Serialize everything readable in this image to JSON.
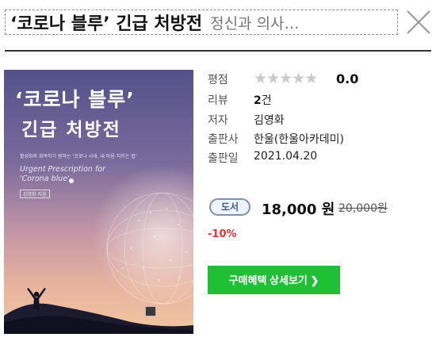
{
  "header": {
    "title": "‘코로나 블루’ 긴급 처방전",
    "subtitle": "정신과 의사…",
    "close_icon": "close-icon"
  },
  "cover": {
    "title_line1": "‘코로나 블루’",
    "title_line2": "긴급 처방전",
    "description": "활성화와 회복하기 원하는 '코로나 시대, 내 마음 지키는 법'",
    "english_title": "Urgent Prescription for 'Corona blue'",
    "author": "김영화 지음"
  },
  "info": {
    "rating": {
      "label": "평점",
      "stars_filled": 0,
      "stars_total": 5,
      "score": "0.0"
    },
    "reviews": {
      "label": "리뷰",
      "count": "2",
      "unit": "건"
    },
    "author": {
      "label": "저자",
      "value": "김영화"
    },
    "publisher": {
      "label": "출판사",
      "value": "한울(한울아카데미)"
    },
    "published": {
      "label": "출판일",
      "value": "2021.04.20"
    }
  },
  "price": {
    "badge": "도서",
    "sale_price": "18,000",
    "unit": "원",
    "original_price": "20,000원",
    "discount": "-10%"
  },
  "buy_button": {
    "label": "구매혜택 상세보기 ❯"
  }
}
